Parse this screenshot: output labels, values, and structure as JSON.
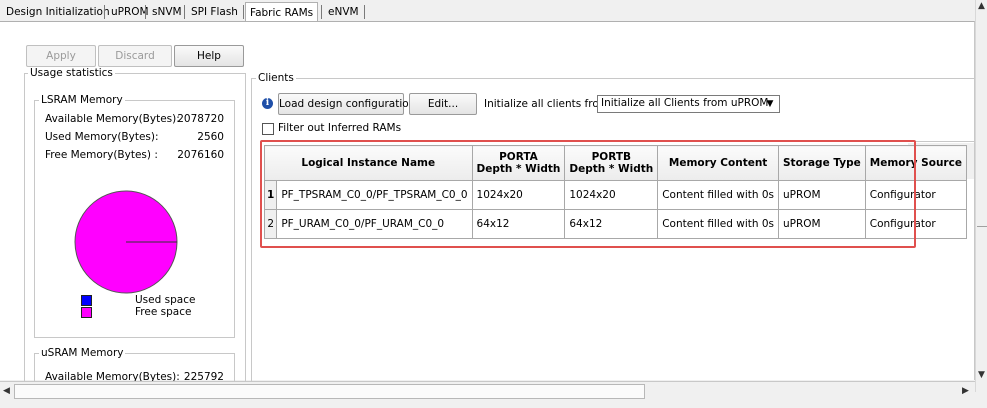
{
  "tabs": [
    "Design Initialization",
    "uPROM",
    "sNVM",
    "SPI Flash",
    "Fabric RAMs",
    "eNVM"
  ],
  "toolbar": {
    "apply": "Apply",
    "discard": "Discard",
    "help": "Help"
  },
  "usage": {
    "title": "Usage statistics",
    "lsram": {
      "title": "LSRAM Memory",
      "rows": [
        {
          "label": "Available Memory(Bytes):",
          "value": "2078720"
        },
        {
          "label": "Used Memory(Bytes):",
          "value": "2560"
        },
        {
          "label": "Free Memory(Bytes) :",
          "value": "2076160"
        }
      ],
      "pie": {
        "used": 2560,
        "free": 2076160
      },
      "legend": [
        {
          "label": "Used space",
          "color": "#0000ff"
        },
        {
          "label": "Free space",
          "color": "#ff00ff"
        }
      ]
    },
    "usram": {
      "title": "uSRAM Memory",
      "rows": [
        {
          "label": "Available Memory(Bytes):",
          "value": "225792"
        }
      ]
    }
  },
  "clients": {
    "title": "Clients",
    "load_button": "Load design configuration",
    "edit_button": "Edit...",
    "init_label": "Initialize all clients from:",
    "init_value": "Initialize all Clients from uPROM",
    "filter_label": "Filter out Inferred RAMs",
    "filter_checked": false,
    "columns": [
      [
        "Logical Instance Name"
      ],
      [
        "PORTA",
        "Depth * Width"
      ],
      [
        "PORTB",
        "Depth * Width"
      ],
      [
        "Memory Content"
      ],
      [
        "Storage Type"
      ],
      [
        "Memory Source"
      ]
    ],
    "rows": [
      {
        "num": "1",
        "cells": [
          "PF_TPSRAM_C0_0/PF_TPSRAM_C0_0",
          "1024x20",
          "1024x20",
          "Content filled with 0s",
          "uPROM",
          "Configurator"
        ]
      },
      {
        "num": "2",
        "cells": [
          "PF_URAM_C0_0/PF_URAM_C0_0",
          "64x12",
          "64x12",
          "Content filled with 0s",
          "uPROM",
          "Configurator"
        ]
      }
    ]
  },
  "colors": {
    "highlight": "#e0504e",
    "info_icon": "#1f4fa8"
  }
}
